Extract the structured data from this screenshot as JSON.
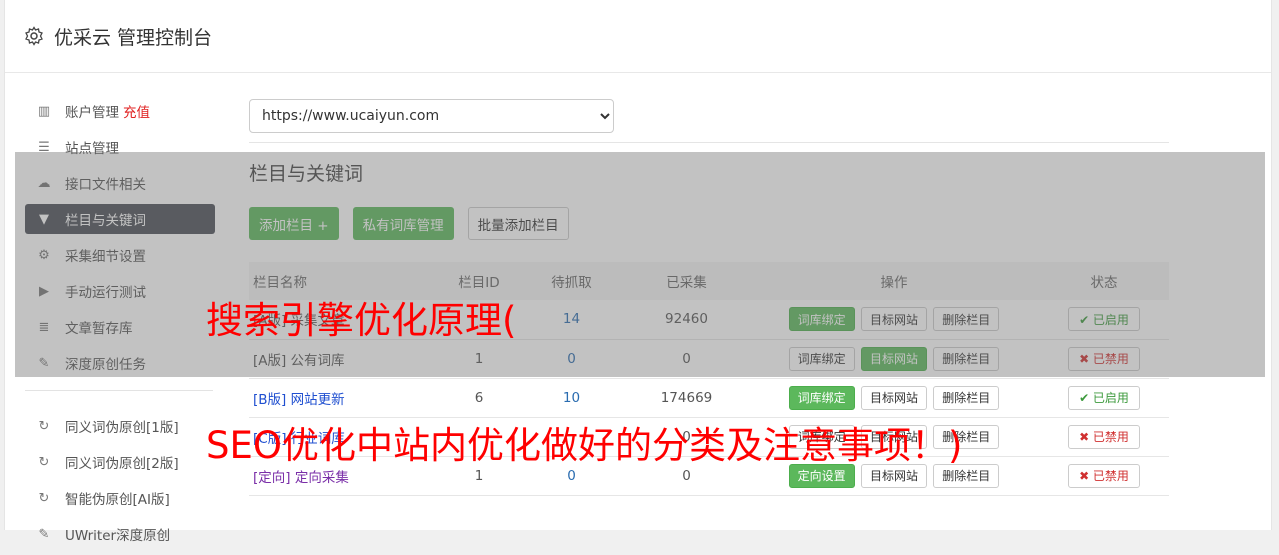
{
  "header": {
    "title": "优采云 管理控制台",
    "icon": "gear-icon"
  },
  "sidebar": {
    "items": [
      {
        "label": "账户管理",
        "extra": "充值",
        "icon": "bar-chart-icon"
      },
      {
        "label": "站点管理",
        "icon": "server-icon"
      },
      {
        "label": "接口文件相关",
        "icon": "cloud-upload-icon"
      },
      {
        "label": "栏目与关键词",
        "icon": "filter-icon"
      },
      {
        "label": "采集细节设置",
        "icon": "gears-icon"
      },
      {
        "label": "手动运行测试",
        "icon": "play-circle-icon"
      },
      {
        "label": "文章暂存库",
        "icon": "database-icon"
      },
      {
        "label": "深度原创任务",
        "icon": "edit-icon"
      }
    ],
    "items2": [
      {
        "label": "同义词伪原创[1版]",
        "icon": "refresh-icon"
      },
      {
        "label": "同义词伪原创[2版]",
        "icon": "refresh-icon"
      },
      {
        "label": "智能伪原创[AI版]",
        "icon": "refresh-icon"
      },
      {
        "label": "UWriter深度原创",
        "icon": "edit-icon"
      }
    ]
  },
  "main": {
    "site_select": "https://www.ucaiyun.com",
    "section_title": "栏目与关键词",
    "buttons": {
      "add": "添加栏目 +",
      "private": "私有词库管理",
      "batch": "批量添加栏目"
    },
    "table": {
      "headers": [
        "栏目名称",
        "栏目ID",
        "待抓取",
        "已采集",
        "操作",
        "状态"
      ],
      "rows": [
        {
          "name": "[A版] 采集文章",
          "id": "",
          "pending": "14",
          "collected": "92460",
          "op1": "词库绑定",
          "op2": "目标网站",
          "op3": "删除栏目",
          "status": "✔ 已启用"
        },
        {
          "name": "[A版] 公有词库",
          "id": "1",
          "pending": "0",
          "collected": "0",
          "op1": "词库绑定",
          "op2": "目标网站",
          "op3": "删除栏目",
          "status": "✖ 已禁用"
        },
        {
          "name": "[B版] 网站更新",
          "id": "6",
          "pending": "10",
          "collected": "174669",
          "op1": "词库绑定",
          "op2": "目标网站",
          "op3": "删除栏目",
          "status": "✔ 已启用"
        },
        {
          "name": "[C版] 行业词库",
          "id": "",
          "pending": "",
          "collected": "0",
          "op1": "词库绑定",
          "op2": "目标网站",
          "op3": "删除栏目",
          "status": "✖ 已禁用"
        },
        {
          "name": "[定向] 定向采集",
          "id": "1",
          "pending": "0",
          "collected": "0",
          "op1": "定向设置",
          "op2": "目标网站",
          "op3": "删除栏目",
          "status": "✖ 已禁用"
        }
      ]
    }
  },
  "overlay_text": {
    "line1": "搜索引擎优化原理(",
    "line2": "SEO优化中站内优化做好的分类及注意事项！)"
  }
}
